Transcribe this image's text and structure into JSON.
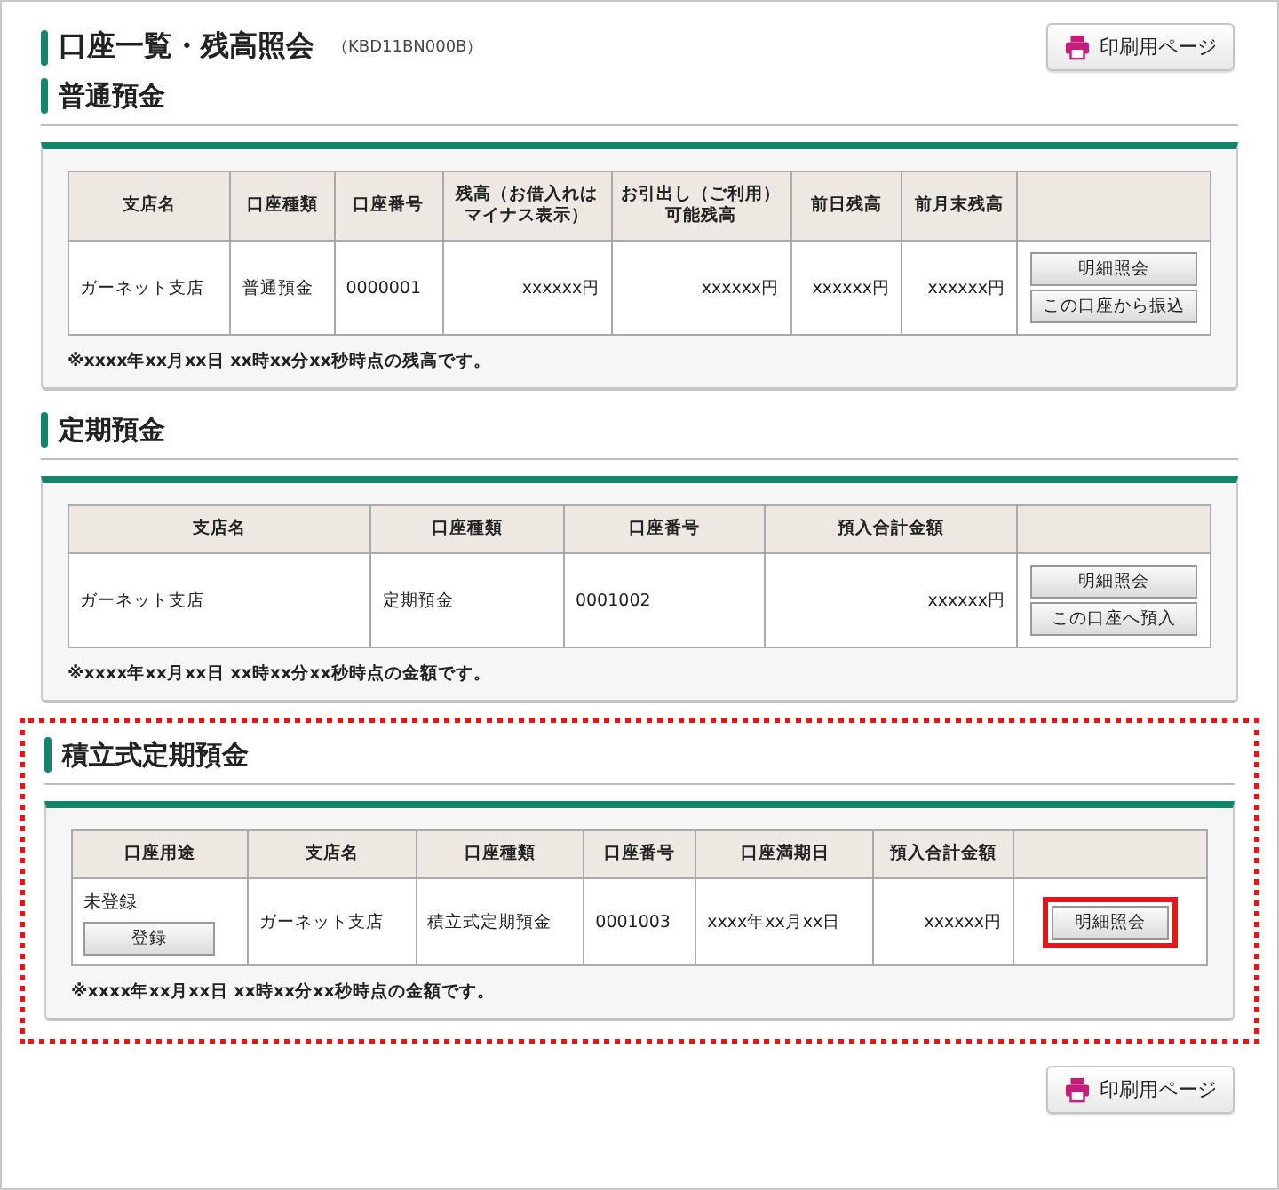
{
  "page": {
    "title": "口座一覧・残高照会",
    "code": "（KBD11BN000B）",
    "print_buttons": [
      {
        "label": "印刷用ページ"
      },
      {
        "label": "印刷用ページ"
      }
    ]
  },
  "sections": [
    {
      "heading": "普通預金",
      "highlighted": false,
      "columns": [
        "支店名",
        "口座種類",
        "口座番号",
        "残高（お借入れはマイナス表示）",
        "お引出し（ご利用）可能残高",
        "前日残高",
        "前月末残高",
        ""
      ],
      "rows": [
        [
          {
            "kind": "text",
            "text": "ガーネット支店"
          },
          {
            "kind": "text",
            "text": "普通預金"
          },
          {
            "kind": "text",
            "text": "0000001"
          },
          {
            "kind": "amount",
            "text": "xxxxxx円"
          },
          {
            "kind": "amount",
            "text": "xxxxxx円"
          },
          {
            "kind": "amount",
            "text": "xxxxxx円"
          },
          {
            "kind": "amount",
            "text": "xxxxxx円"
          },
          {
            "kind": "actions",
            "buttons": [
              {
                "label": "明細照会",
                "highlighted": false
              },
              {
                "label": "この口座から振込",
                "highlighted": false
              }
            ]
          }
        ]
      ],
      "note": "※xxxx年xx月xx日 xx時xx分xx秒時点の残高です。"
    },
    {
      "heading": "定期預金",
      "highlighted": false,
      "columns": [
        "支店名",
        "口座種類",
        "口座番号",
        "預入合計金額",
        ""
      ],
      "rows": [
        [
          {
            "kind": "text",
            "text": "ガーネット支店"
          },
          {
            "kind": "text",
            "text": "定期預金"
          },
          {
            "kind": "text",
            "text": "0001002"
          },
          {
            "kind": "amount",
            "text": "xxxxxx円"
          },
          {
            "kind": "actions",
            "buttons": [
              {
                "label": "明細照会",
                "highlighted": false
              },
              {
                "label": "この口座へ預入",
                "highlighted": false
              }
            ]
          }
        ]
      ],
      "note": "※xxxx年xx月xx日 xx時xx分xx秒時点の金額です。"
    },
    {
      "heading": "積立式定期預金",
      "highlighted": true,
      "columns": [
        "口座用途",
        "支店名",
        "口座種類",
        "口座番号",
        "口座満期日",
        "預入合計金額",
        ""
      ],
      "rows": [
        [
          {
            "kind": "status",
            "text": "未登録",
            "button": {
              "label": "登録"
            }
          },
          {
            "kind": "text",
            "text": "ガーネット支店"
          },
          {
            "kind": "text",
            "text": "積立式定期預金"
          },
          {
            "kind": "text",
            "text": "0001003"
          },
          {
            "kind": "text",
            "text": "xxxx年xx月xx日"
          },
          {
            "kind": "amount",
            "text": "xxxxxx円"
          },
          {
            "kind": "actions",
            "buttons": [
              {
                "label": "明細照会",
                "highlighted": true
              }
            ]
          }
        ]
      ],
      "note": "※xxxx年xx月xx日 xx時xx分xx秒時点の金額です。"
    }
  ]
}
